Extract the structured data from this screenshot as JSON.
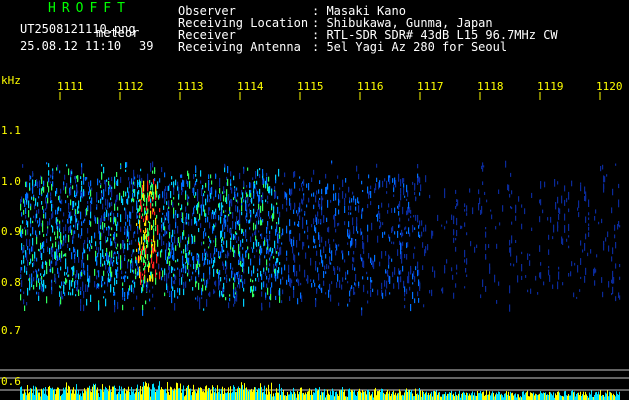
{
  "header": {
    "logo": "HROFFT",
    "filename": "UT2508121110.png",
    "type_label": "meteor",
    "datetime": "25.08.12 11:10",
    "count": "39"
  },
  "info": {
    "labels": [
      "Observer",
      "Receiving Location",
      "Receiver",
      "Receiving Antenna"
    ],
    "values": [
      ": Masaki Kano",
      ": Shibukawa, Gunma, Japan",
      ": RTL-SDR SDR# 43dB L15 96.7MHz CW",
      ": 5el Yagi Az 280 for Seoul"
    ]
  },
  "colors": {
    "background": "#000000",
    "logo": "#00ff00",
    "text": "#ffffff",
    "axis": "#ffff00",
    "grid": "#c8c8c8"
  },
  "chart_data": {
    "type": "heatmap",
    "yunit": "kHz",
    "x_ticks": [
      "1111",
      "1112",
      "1113",
      "1114",
      "1115",
      "1116",
      "1117",
      "1118",
      "1119",
      "1120"
    ],
    "y_ticks": [
      "1.1",
      "1.0",
      "0.9",
      "0.8",
      "0.7",
      "0.6"
    ],
    "ylim": [
      0.6,
      1.15
    ],
    "grid": false
  }
}
